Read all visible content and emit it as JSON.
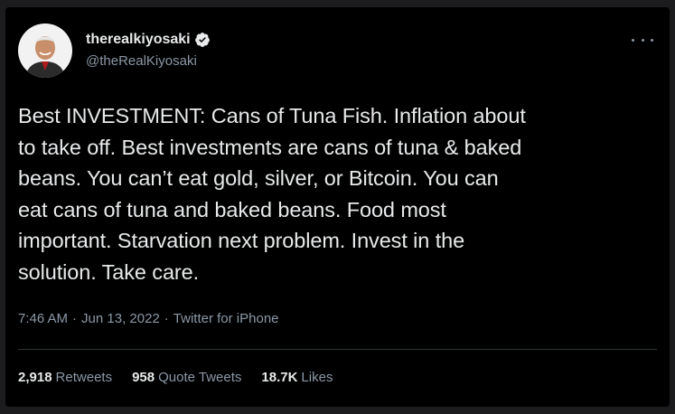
{
  "tweet": {
    "author": {
      "display_name": "therealkiyosaki",
      "handle": "@theRealKiyosaki",
      "verified": true,
      "verified_color": "#e7e9ea"
    },
    "text": "Best INVESTMENT:  Cans of Tuna Fish. Inflation about\nto take off.  Best investments are cans of tuna & baked\nbeans. You can’t eat gold, silver, or Bitcoin. You can\neat cans of tuna and baked beans. Food most\nimportant. Starvation next problem. Invest in the\nsolution. Take care.",
    "time": "7:46 AM",
    "separator": "·",
    "date": "Jun 13, 2022",
    "source": "Twitter for iPhone",
    "stats": {
      "retweets_count": "2,918",
      "retweets_label": "Retweets",
      "quotes_count": "958",
      "quotes_label": "Quote Tweets",
      "likes_count": "18.7K",
      "likes_label": "Likes"
    }
  },
  "icons": {
    "more": "more-options-icon",
    "verified": "verified-badge-icon"
  }
}
